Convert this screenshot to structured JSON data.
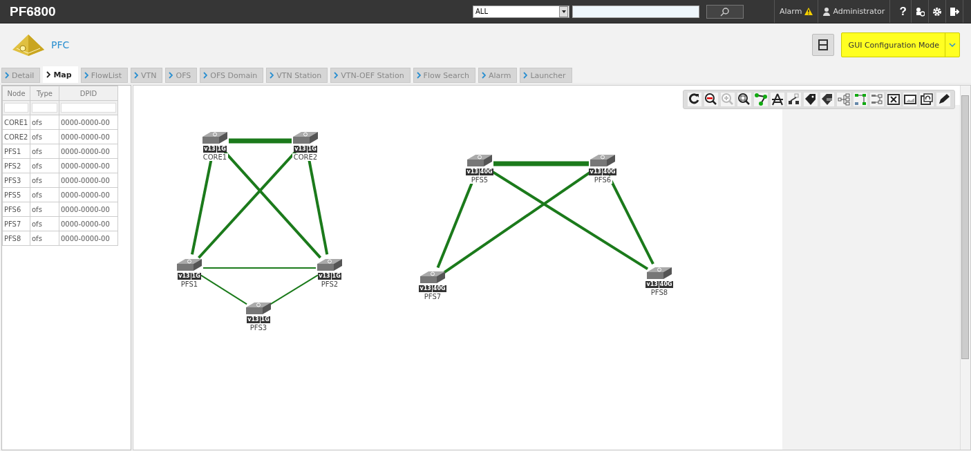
{
  "topbar": {
    "product": "PF6800",
    "scope_select": "ALL",
    "alarm": "Alarm",
    "user": "Administrator",
    "help": "?"
  },
  "header": {
    "app": "PFC",
    "mode_button": "GUI Configuration Mode"
  },
  "tabs": [
    {
      "label": "Detail",
      "selected": false
    },
    {
      "label": "Map",
      "selected": true
    },
    {
      "label": "FlowList",
      "selected": false
    },
    {
      "label": "VTN",
      "selected": false
    },
    {
      "label": "OFS",
      "selected": false
    },
    {
      "label": "OFS Domain",
      "selected": false
    },
    {
      "label": "VTN Station",
      "selected": false
    },
    {
      "label": "VTN-OEF Station",
      "selected": false
    },
    {
      "label": "Flow Search",
      "selected": false
    },
    {
      "label": "Alarm",
      "selected": false
    },
    {
      "label": "Launcher",
      "selected": false
    }
  ],
  "table": {
    "columns": [
      "Node",
      "Type",
      "DPID"
    ],
    "rows": [
      [
        "CORE1",
        "ofs",
        "0000-0000-00"
      ],
      [
        "CORE2",
        "ofs",
        "0000-0000-00"
      ],
      [
        "PFS1",
        "ofs",
        "0000-0000-00"
      ],
      [
        "PFS2",
        "ofs",
        "0000-0000-00"
      ],
      [
        "PFS3",
        "ofs",
        "0000-0000-00"
      ],
      [
        "PFS5",
        "ofs",
        "0000-0000-00"
      ],
      [
        "PFS6",
        "ofs",
        "0000-0000-00"
      ],
      [
        "PFS7",
        "ofs",
        "0000-0000-00"
      ],
      [
        "PFS8",
        "ofs",
        "0000-0000-00"
      ]
    ]
  },
  "map": {
    "nodes": [
      {
        "name": "CORE1",
        "version": "v13",
        "speed": "1G"
      },
      {
        "name": "CORE2",
        "version": "v13",
        "speed": "1G"
      },
      {
        "name": "PFS1",
        "version": "v13",
        "speed": "1G"
      },
      {
        "name": "PFS2",
        "version": "v13",
        "speed": "1G"
      },
      {
        "name": "PFS3",
        "version": "v13",
        "speed": "1G"
      },
      {
        "name": "PFS5",
        "version": "v13",
        "speed": "40G"
      },
      {
        "name": "PFS6",
        "version": "v13",
        "speed": "40G"
      },
      {
        "name": "PFS7",
        "version": "v13",
        "speed": "40G"
      },
      {
        "name": "PFS8",
        "version": "v13",
        "speed": "40G"
      }
    ],
    "links": [
      {
        "kind": "trunk"
      },
      {
        "kind": "normal"
      },
      {
        "kind": "normal"
      },
      {
        "kind": "normal"
      },
      {
        "kind": "normal"
      },
      {
        "kind": "thin"
      },
      {
        "kind": "thin"
      },
      {
        "kind": "thin"
      },
      {
        "kind": "trunk"
      },
      {
        "kind": "normal"
      },
      {
        "kind": "normal"
      },
      {
        "kind": "normal"
      },
      {
        "kind": "normal"
      }
    ]
  }
}
